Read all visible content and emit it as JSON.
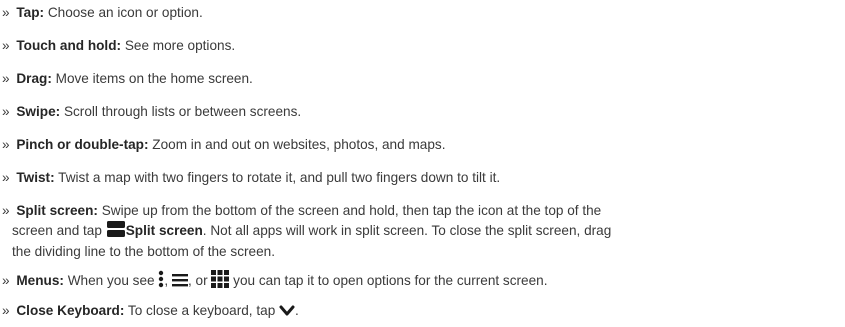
{
  "bullet": "»",
  "items": [
    {
      "term": "Tap:",
      "text": "Choose an icon or option."
    },
    {
      "term": "Touch and hold:",
      "text": "See more options."
    },
    {
      "term": "Drag:",
      "text": "Move items on the home screen."
    },
    {
      "term": "Swipe:",
      "text": "Scroll through lists or between screens."
    },
    {
      "term": "Pinch or double-tap:",
      "text": "Zoom in and out on websites, photos, and maps."
    },
    {
      "term": "Twist:",
      "text": "Twist a map with two fingers to rotate it, and pull two fingers down to tilt it."
    },
    {
      "term": "Split screen:",
      "text_line1": "Swipe up from the bottom of the screen and hold, then tap the icon at the top of the",
      "text_line2a": "screen and tap",
      "inline_label": "Split screen",
      "text_line2b": ". Not all apps will work in split screen. To close the split screen, drag",
      "text_line3": "the dividing line to the bottom of the screen.",
      "icon": "split-screen-icon"
    },
    {
      "term": "Menus:",
      "text_a": "When you see",
      "sep1": ",",
      "sep2": ", or",
      "text_b": "you can tap it to open options for the current screen.",
      "icons": [
        "more-vertical-icon",
        "hamburger-menu-icon",
        "apps-grid-icon"
      ]
    },
    {
      "term": "Close Keyboard:",
      "text": "To close a keyboard, tap",
      "end": ".",
      "icon": "chevron-down-icon"
    }
  ],
  "colors": {
    "text": "#3a3a3a",
    "term": "#262626",
    "icon": "#1a1a1a"
  }
}
